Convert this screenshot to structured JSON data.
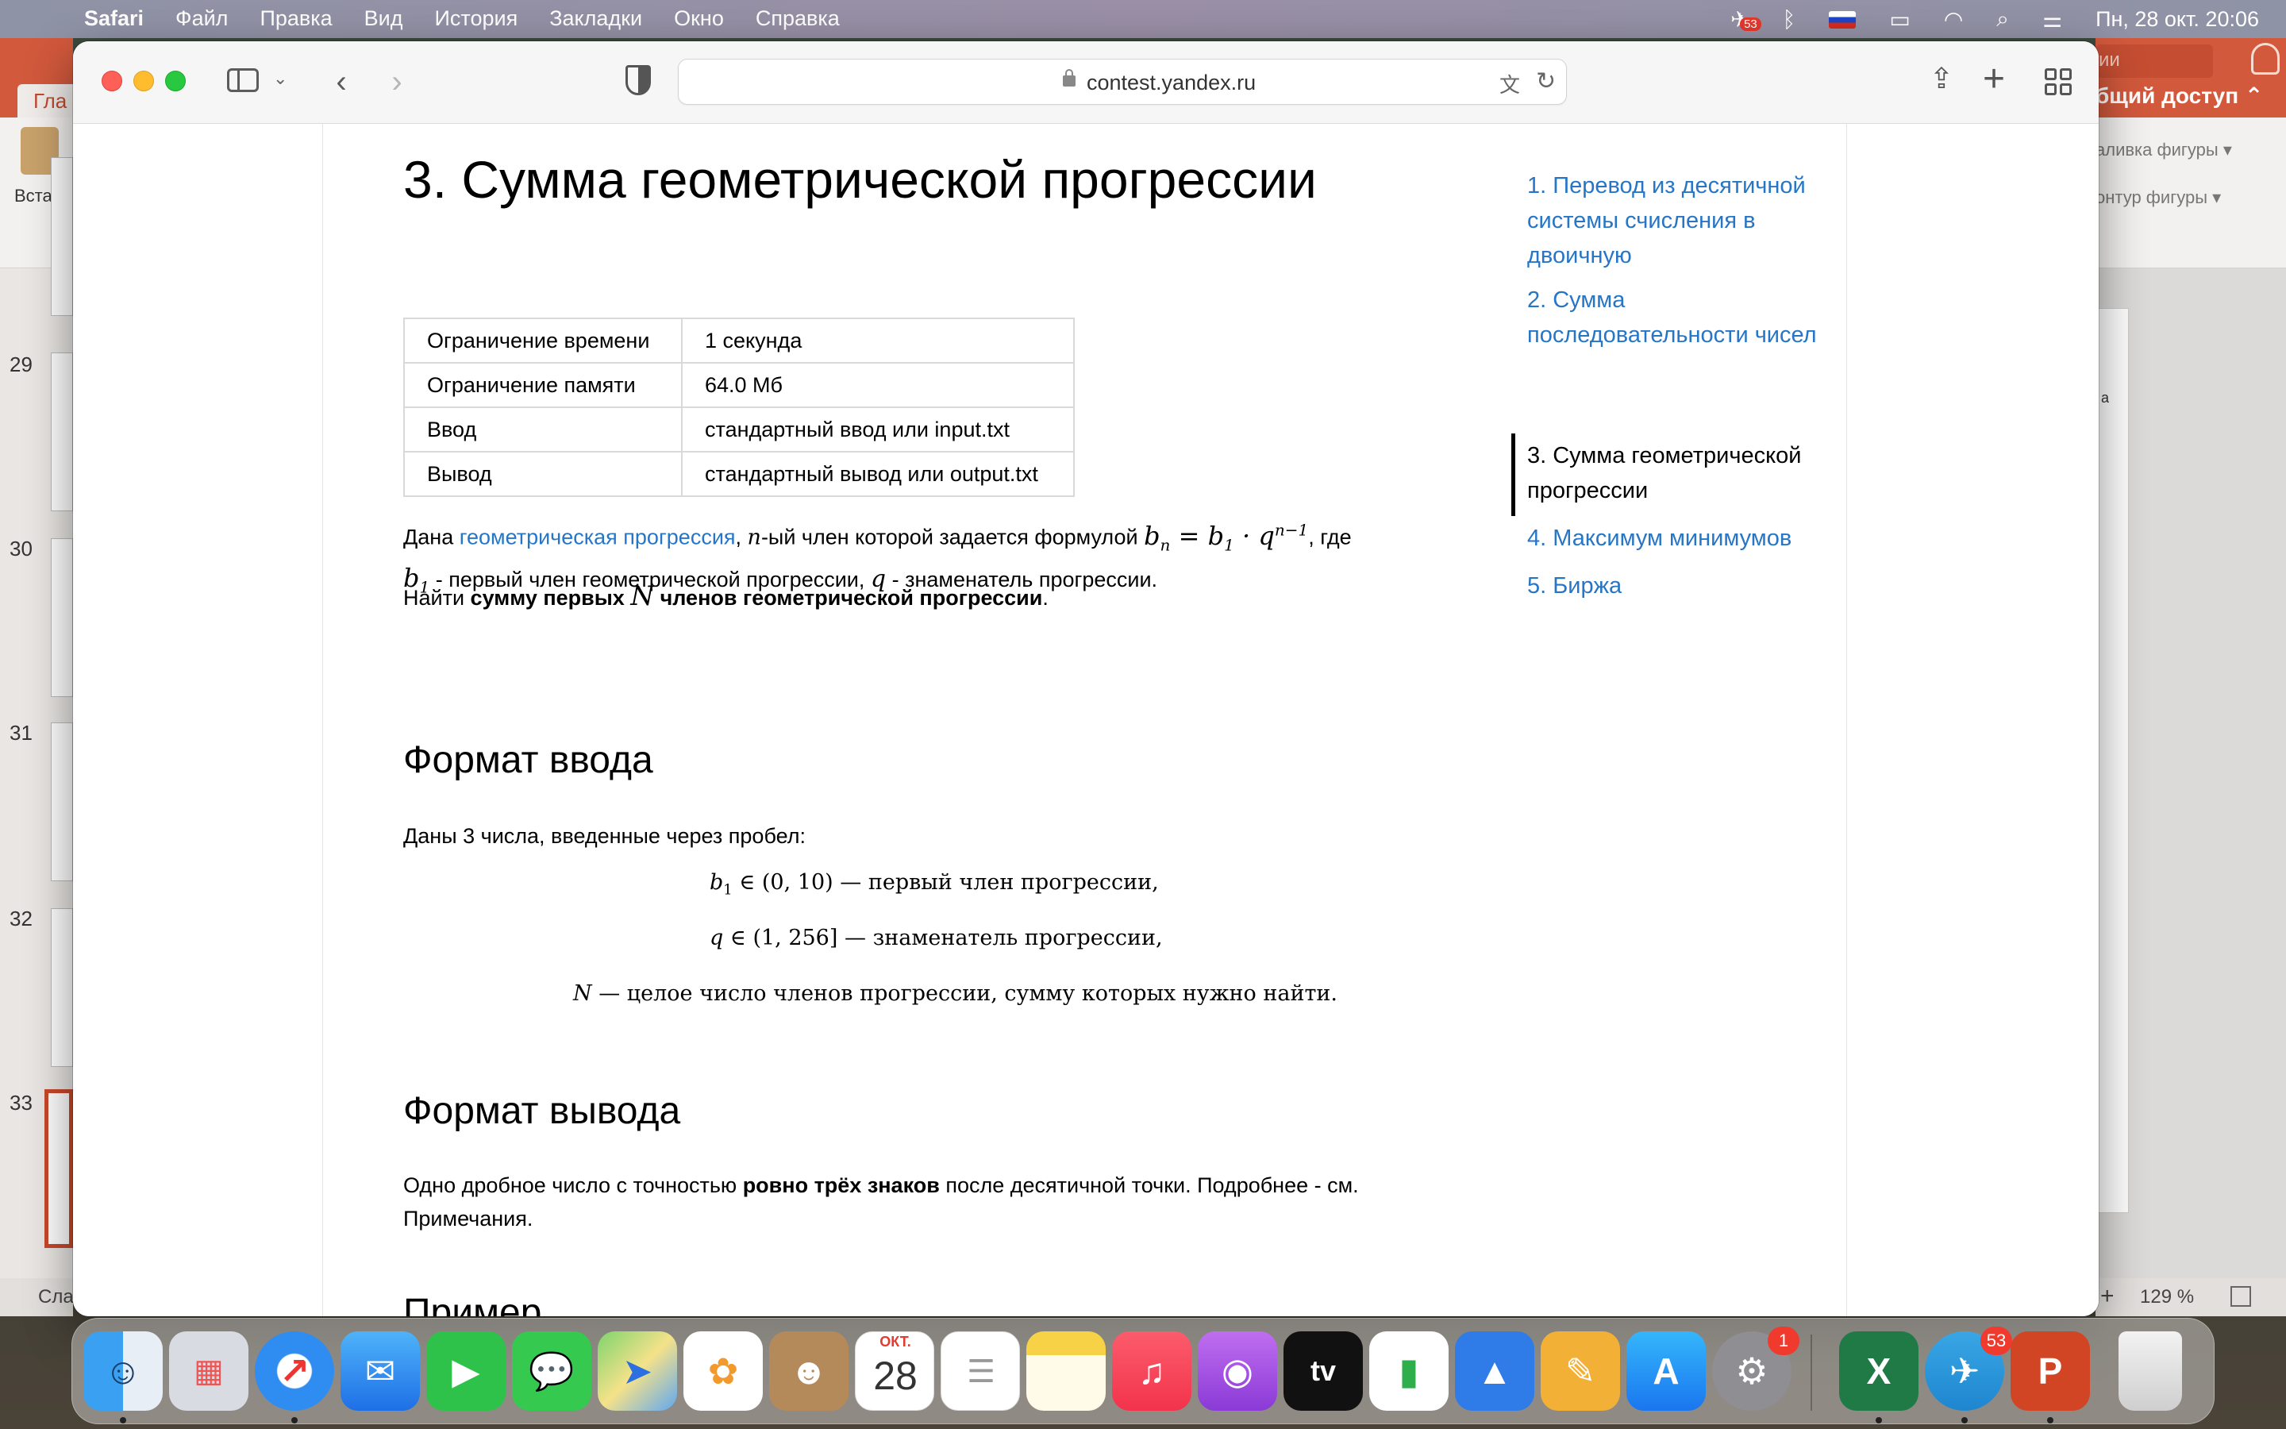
{
  "menubar": {
    "app": "Safari",
    "items": [
      "Файл",
      "Правка",
      "Вид",
      "История",
      "Закладки",
      "Окно",
      "Справка"
    ],
    "datetime": "Пн, 28 окт.  20:06",
    "telegram_badge": "53"
  },
  "powerpoint": {
    "tab_left": "Гла",
    "paste_label": "Встави",
    "slide_numbers": [
      "29",
      "30",
      "31",
      "32",
      "33"
    ],
    "status_left": "Сла",
    "search_placeholder": "ии",
    "share_label": "бщий доступ",
    "shape_fill": "аливка фигуры",
    "shape_outline": "онтур фигуры",
    "slide_letter": "а",
    "zoom": "129 %"
  },
  "browser": {
    "url": "contest.yandex.ru"
  },
  "problem": {
    "title": "3. Сумма геометрической прогрессии",
    "limits": [
      {
        "key": "Ограничение времени",
        "value": "1 секунда"
      },
      {
        "key": "Ограничение памяти",
        "value": "64.0 Мб"
      },
      {
        "key": "Ввод",
        "value": "стандартный ввод или input.txt"
      },
      {
        "key": "Вывод",
        "value": "стандартный вывод или output.txt"
      }
    ],
    "statement": {
      "p1_a": "Дана ",
      "p1_link": "геометрическая прогрессия",
      "p1_b": "-ый член которой задается формулой ",
      "p1_c": ", где",
      "p1_d": " - первый член геометрической прогрессии, ",
      "p1_e": " - знаменатель прогрессии.",
      "p2_a": "Найти ",
      "p2_bold_a": "сумму первых ",
      "p2_bold_b": " членов геометрической прогрессии",
      "p2_end": "."
    },
    "input_heading": "Формат ввода",
    "input_text": "Даны 3 числа, введенные через пробел:",
    "input_lines": [
      "— первый член прогрессии,",
      "— знаменатель прогрессии,",
      "— целое число членов прогрессии, сумму которых нужно найти."
    ],
    "output_heading": "Формат вывода",
    "output_a": "Одно дробное число с точностью ",
    "output_bold": "ровно трёх знаков",
    "output_b": " после десятичной точки. Подробнее - см.",
    "output_c": "Примечания.",
    "example_heading": "Пример"
  },
  "toc": [
    {
      "label": "1. Перевод из десятичной системы счисления в двоичную"
    },
    {
      "label": "2. Сумма последовательности чисел"
    },
    {
      "label": "3. Сумма геометрической прогрессии",
      "active": true
    },
    {
      "label": "4. Максимум минимумов"
    },
    {
      "label": "5. Биржа"
    }
  ],
  "dock": {
    "calendar_month": "ОКТ.",
    "calendar_day": "28",
    "settings_badge": "1",
    "telegram_badge": "53"
  }
}
